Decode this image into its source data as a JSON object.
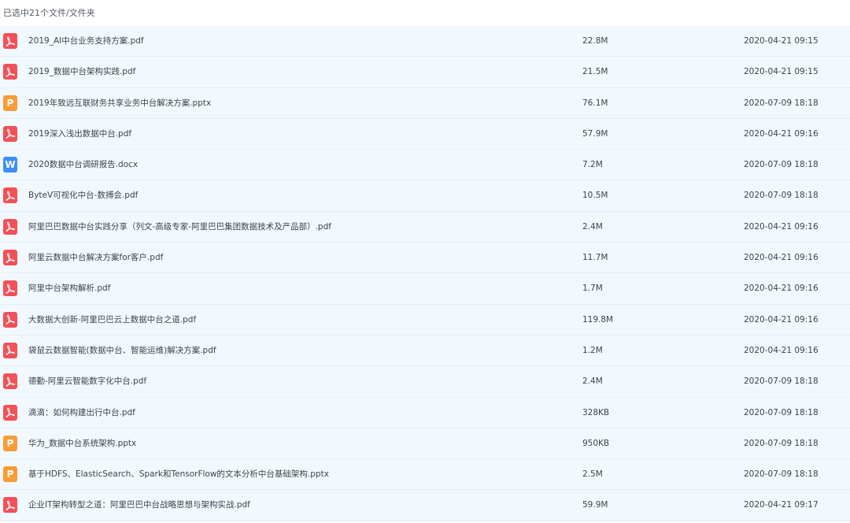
{
  "header": {
    "selection_text": "已选中21个文件/文件夹"
  },
  "colors": {
    "pdf": "#f25157",
    "pptx": "#f99b36",
    "docx": "#3d8ef7",
    "row_bg": "#f2f9fe"
  },
  "files": [
    {
      "name": "2019_AI中台业务支持方案.pdf",
      "size": "22.8M",
      "date": "2020-04-21 09:15",
      "type": "pdf",
      "icon": "pdf-icon"
    },
    {
      "name": "2019_数据中台架构实践.pdf",
      "size": "21.5M",
      "date": "2020-04-21 09:15",
      "type": "pdf",
      "icon": "pdf-icon"
    },
    {
      "name": "2019年致远互联财务共享业务中台解决方案.pptx",
      "size": "76.1M",
      "date": "2020-07-09 18:18",
      "type": "pptx",
      "icon": "pptx-icon"
    },
    {
      "name": "2019深入浅出数据中台.pdf",
      "size": "57.9M",
      "date": "2020-04-21 09:16",
      "type": "pdf",
      "icon": "pdf-icon"
    },
    {
      "name": "2020数据中台调研报告.docx",
      "size": "7.2M",
      "date": "2020-07-09 18:18",
      "type": "docx",
      "icon": "docx-icon"
    },
    {
      "name": "ByteV可视化中台-数搏会.pdf",
      "size": "10.5M",
      "date": "2020-07-09 18:18",
      "type": "pdf",
      "icon": "pdf-icon"
    },
    {
      "name": "阿里巴巴数据中台实践分享（列文-高级专家-阿里巴巴集团数据技术及产品部）.pdf",
      "size": "2.4M",
      "date": "2020-04-21 09:16",
      "type": "pdf",
      "icon": "pdf-icon"
    },
    {
      "name": "阿里云数据中台解决方案for客户.pdf",
      "size": "11.7M",
      "date": "2020-04-21 09:16",
      "type": "pdf",
      "icon": "pdf-icon"
    },
    {
      "name": "阿里中台架构解析.pdf",
      "size": "1.7M",
      "date": "2020-04-21 09:16",
      "type": "pdf",
      "icon": "pdf-icon"
    },
    {
      "name": "大数据大创新-阿里巴巴云上数据中台之道.pdf",
      "size": "119.8M",
      "date": "2020-04-21 09:16",
      "type": "pdf",
      "icon": "pdf-icon"
    },
    {
      "name": "袋鼠云数据智能(数据中台、智能运维)解决方案.pdf",
      "size": "1.2M",
      "date": "2020-04-21 09:16",
      "type": "pdf",
      "icon": "pdf-icon"
    },
    {
      "name": "德勤-阿里云智能数字化中台.pdf",
      "size": "2.4M",
      "date": "2020-07-09 18:18",
      "type": "pdf",
      "icon": "pdf-icon"
    },
    {
      "name": "滴滴：如何构建出行中台.pdf",
      "size": "328KB",
      "date": "2020-07-09 18:18",
      "type": "pdf",
      "icon": "pdf-icon"
    },
    {
      "name": "华为_数据中台系统架构.pptx",
      "size": "950KB",
      "date": "2020-07-09 18:18",
      "type": "pptx",
      "icon": "pptx-icon"
    },
    {
      "name": "基于HDFS、ElasticSearch、Spark和TensorFlow的文本分析中台基础架构.pptx",
      "size": "2.5M",
      "date": "2020-07-09 18:18",
      "type": "pptx",
      "icon": "pptx-icon"
    },
    {
      "name": "企业IT架构转型之道：阿里巴巴中台战略思想与架构实战.pdf",
      "size": "59.9M",
      "date": "2020-04-21 09:17",
      "type": "pdf",
      "icon": "pdf-icon"
    }
  ]
}
